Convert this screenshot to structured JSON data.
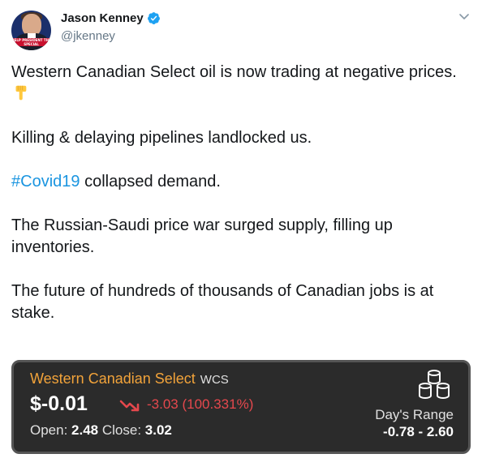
{
  "author": {
    "display_name": "Jason Kenney",
    "handle": "@jkenney",
    "verified": true,
    "avatar_banner_text": "HELP PRESIDENT THE SPECIAL"
  },
  "tweet": {
    "paragraphs": [
      {
        "text": "Western Canadian Select oil is now trading at negative prices.",
        "emoji": "backhand-index-pointing-down"
      },
      {
        "text": "Killing & delaying pipelines landlocked us."
      },
      {
        "hashtag": "#Covid19",
        "text": " collapsed demand."
      },
      {
        "text": "The Russian-Saudi price war surged supply, filling up inventories."
      },
      {
        "text": "The future of hundreds of thousands of Canadian jobs is at stake."
      }
    ]
  },
  "stock_card": {
    "title": "Western Canadian Select",
    "ticker": "WCS",
    "price": "$-0.01",
    "change": "-3.03 (100.331%)",
    "open_label": "Open:",
    "open_value": "2.48",
    "close_label": "Close:",
    "close_value": "3.02",
    "range_label": "Day's Range",
    "range_value": "-0.78 - 2.60",
    "colors": {
      "title": "#f2a33a",
      "down": "#e5484d",
      "background": "#2b2b2b"
    },
    "icon": "database-stack-icon"
  },
  "colors": {
    "hashtag": "#1b95e0",
    "verified": "#1da1f2",
    "handle": "#657786"
  }
}
